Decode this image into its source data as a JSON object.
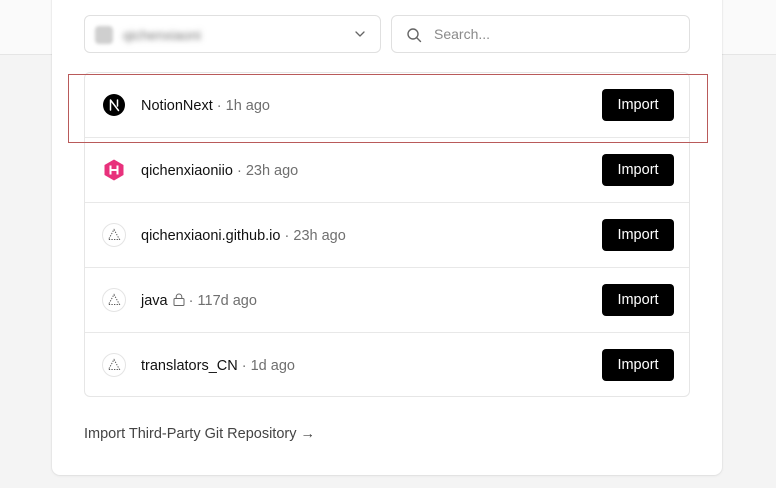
{
  "scope_selector": {
    "account_name": "qichenxiaoni"
  },
  "search": {
    "placeholder": "Search..."
  },
  "repositories": [
    {
      "name": "NotionNext",
      "separator": "·",
      "time": "1h ago",
      "icon": "nextjs-icon",
      "private": false,
      "import_label": "Import"
    },
    {
      "name": "qichenxiaoniio",
      "separator": "·",
      "time": "23h ago",
      "icon": "hexo-icon",
      "private": false,
      "import_label": "Import"
    },
    {
      "name": "qichenxiaoni.github.io",
      "separator": "·",
      "time": "23h ago",
      "icon": "triangle-icon",
      "private": false,
      "import_label": "Import"
    },
    {
      "name": "java",
      "separator": "·",
      "time": "117d ago",
      "icon": "triangle-icon",
      "private": true,
      "import_label": "Import"
    },
    {
      "name": "translators_CN",
      "separator": "·",
      "time": "1d ago",
      "icon": "triangle-icon",
      "private": false,
      "import_label": "Import"
    }
  ],
  "third_party_link": "Import Third-Party Git Repository →",
  "colors": {
    "button_bg": "#000000",
    "hexo_pink": "#e8317c",
    "highlight_border": "#b95a5a"
  }
}
